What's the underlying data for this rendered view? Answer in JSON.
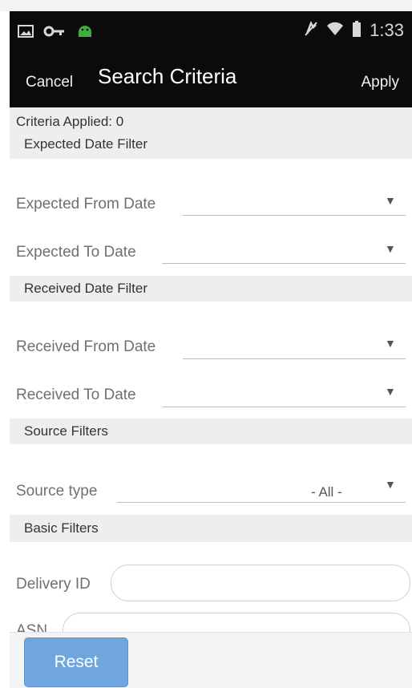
{
  "status_bar": {
    "icons_left": [
      "image-icon",
      "key-icon",
      "android-icon"
    ],
    "icons_right": [
      "mute-icon",
      "wifi-icon",
      "battery-icon"
    ],
    "time": "1:33"
  },
  "header": {
    "cancel_label": "Cancel",
    "title": "Search Criteria",
    "apply_label": "Apply"
  },
  "criteria_applied": "Criteria Applied: 0",
  "sections": {
    "expected": {
      "title": "Expected Date Filter",
      "from_label": "Expected From Date",
      "to_label": "Expected To Date"
    },
    "received": {
      "title": "Received Date Filter",
      "from_label": "Received From Date",
      "to_label": "Received To Date"
    },
    "source": {
      "title": "Source Filters",
      "type_label": "Source type",
      "type_value": "- All -"
    },
    "basic": {
      "title": "Basic Filters",
      "delivery_label": "Delivery ID",
      "asn_label": "ASN"
    }
  },
  "footer": {
    "reset_label": "Reset"
  },
  "colors": {
    "header_bg": "#0b0b0b",
    "band_bg": "#eeeeee",
    "reset_bg": "#6fa6de"
  }
}
